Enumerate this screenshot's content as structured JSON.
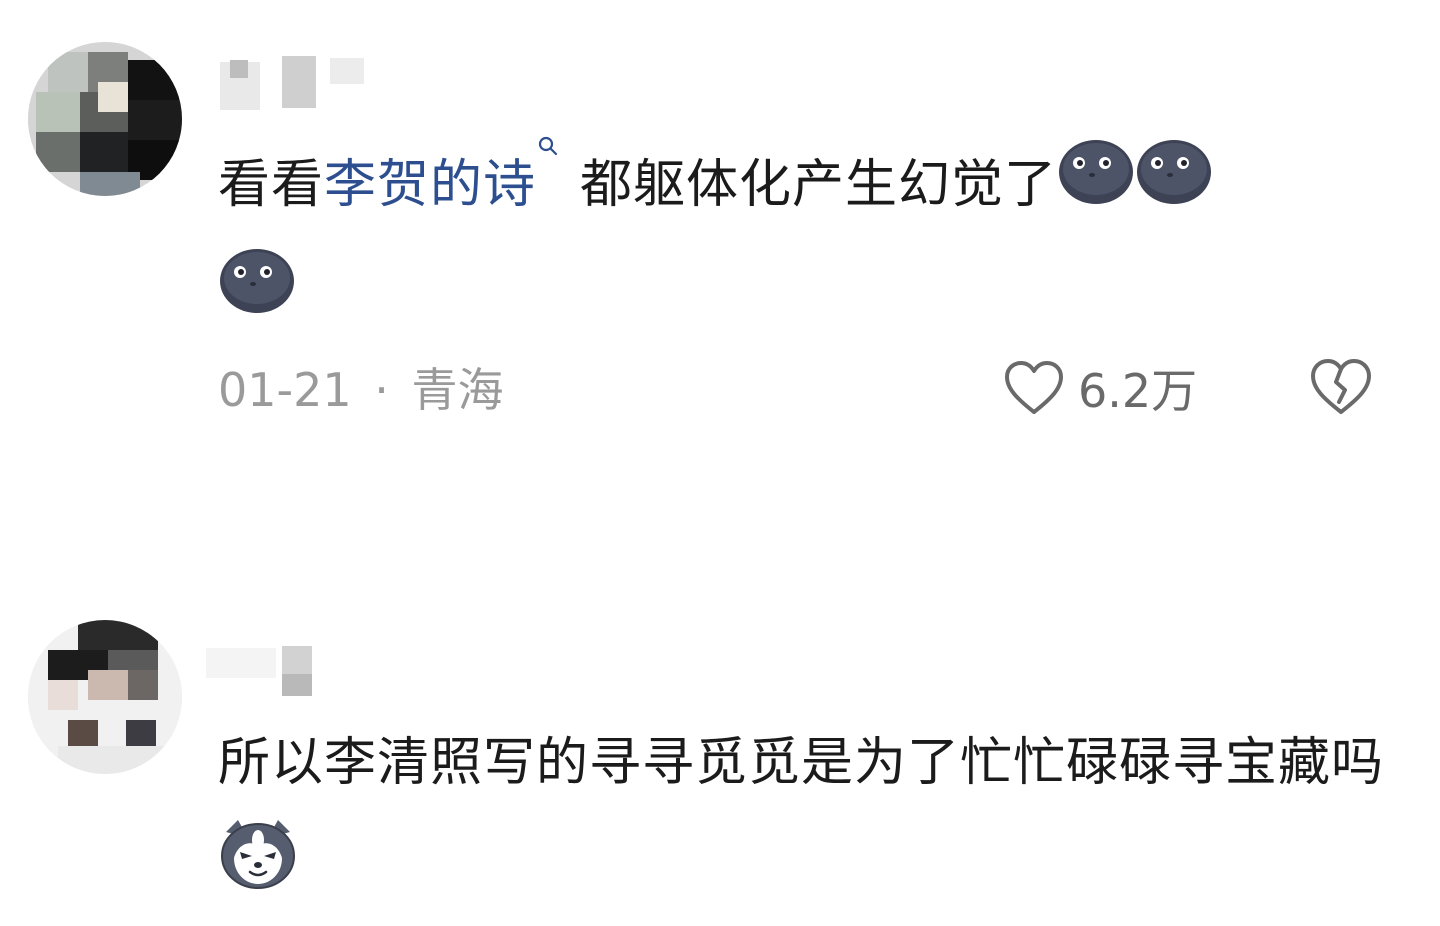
{
  "comments": [
    {
      "text_before_link": "看看",
      "link_text": "李贺的诗",
      "text_after_link": "都躯体化产生幻觉了",
      "emoji": "dark-blob-emoji",
      "emoji_count": 3,
      "date": "01-21",
      "separator": "·",
      "location": "青海",
      "likes": "6.2万"
    },
    {
      "text": "所以李清照写的寻寻觅觅是为了忙忙碌碌寻宝藏吗",
      "emoji": "husky-dog-emoji"
    }
  ]
}
